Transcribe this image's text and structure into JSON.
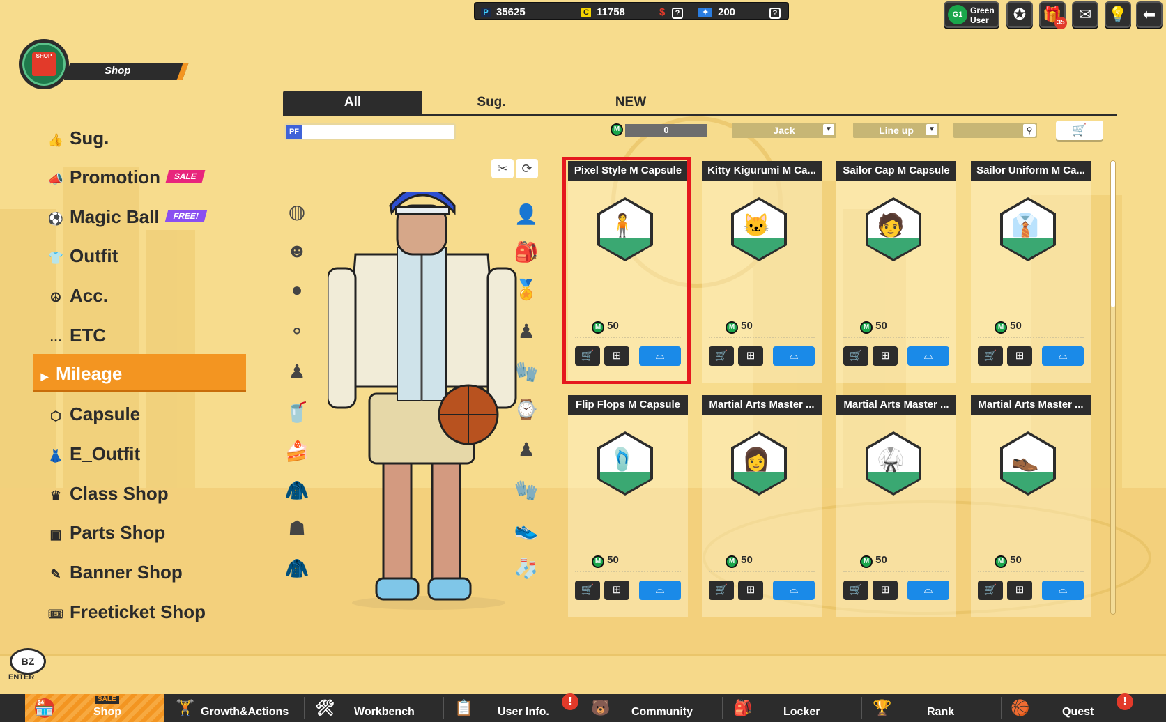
{
  "currencies": {
    "p_icon": "P",
    "p_value": "35625",
    "c_icon": "C",
    "c_value": "11758",
    "dollar_icon": "$",
    "ticket_value": "200",
    "help": "?"
  },
  "top_right": {
    "grade": "G1",
    "user_label": "Green User",
    "gift_count": "35"
  },
  "shop_header": {
    "title": "Shop",
    "logo_text": "SHOP"
  },
  "menu": {
    "items": [
      {
        "label": "Sug.",
        "icon": "thumbs-up"
      },
      {
        "label": "Promotion",
        "icon": "megaphone",
        "tag": "SALE"
      },
      {
        "label": "Magic Ball",
        "icon": "ball",
        "tag": "FREE!"
      },
      {
        "label": "Outfit",
        "icon": "shirt"
      },
      {
        "label": "Acc.",
        "icon": "accessory"
      },
      {
        "label": "ETC",
        "icon": "dots"
      },
      {
        "label": "Mileage",
        "icon": "arrow",
        "active": true
      },
      {
        "label": "Capsule",
        "icon": "cube"
      },
      {
        "label": "E_Outfit",
        "icon": "outfit"
      },
      {
        "label": "Class Shop",
        "icon": "crown"
      },
      {
        "label": "Parts Shop",
        "icon": "parts"
      },
      {
        "label": "Banner Shop",
        "icon": "banner"
      },
      {
        "label": "Freeticket Shop",
        "icon": "ticket"
      }
    ]
  },
  "tabs": [
    {
      "label": "All",
      "active": true
    },
    {
      "label": "Sug."
    },
    {
      "label": "NEW"
    }
  ],
  "filters": {
    "pf_label": "PF",
    "mileage_value": "0",
    "character": "Jack",
    "sort": "Line up",
    "search_placeholder": ""
  },
  "products": [
    {
      "title": "Pixel Style M Capsule",
      "price": "50",
      "selected": true
    },
    {
      "title": "Kitty Kigurumi M Ca...",
      "price": "50"
    },
    {
      "title": "Sailor Cap M Capsule",
      "price": "50"
    },
    {
      "title": "Sailor Uniform M Ca...",
      "price": "50"
    },
    {
      "title": "Flip Flops M Capsule",
      "price": "50"
    },
    {
      "title": "Martial Arts Master ...",
      "price": "50"
    },
    {
      "title": "Martial Arts Master ...",
      "price": "50"
    },
    {
      "title": "Martial Arts Master ...",
      "price": "50"
    }
  ],
  "bz": {
    "label": "BZ",
    "enter": "ENTER"
  },
  "bottom_nav": [
    {
      "label": "Shop",
      "tag": "SALE",
      "active": true
    },
    {
      "label": "Growth&Actions"
    },
    {
      "label": "Workbench"
    },
    {
      "label": "User Info.",
      "alert": "!"
    },
    {
      "label": "Community"
    },
    {
      "label": "Locker"
    },
    {
      "label": "Rank"
    },
    {
      "label": "Quest",
      "alert": "!"
    }
  ],
  "colors": {
    "accent": "#f39521",
    "dark": "#2c2c2c",
    "highlight": "#e5181e",
    "buy_blue": "#1a8ae8",
    "mileage_green": "#1aa64b",
    "sale_pink": "#e8257c",
    "free_purple": "#8a4ff0"
  }
}
